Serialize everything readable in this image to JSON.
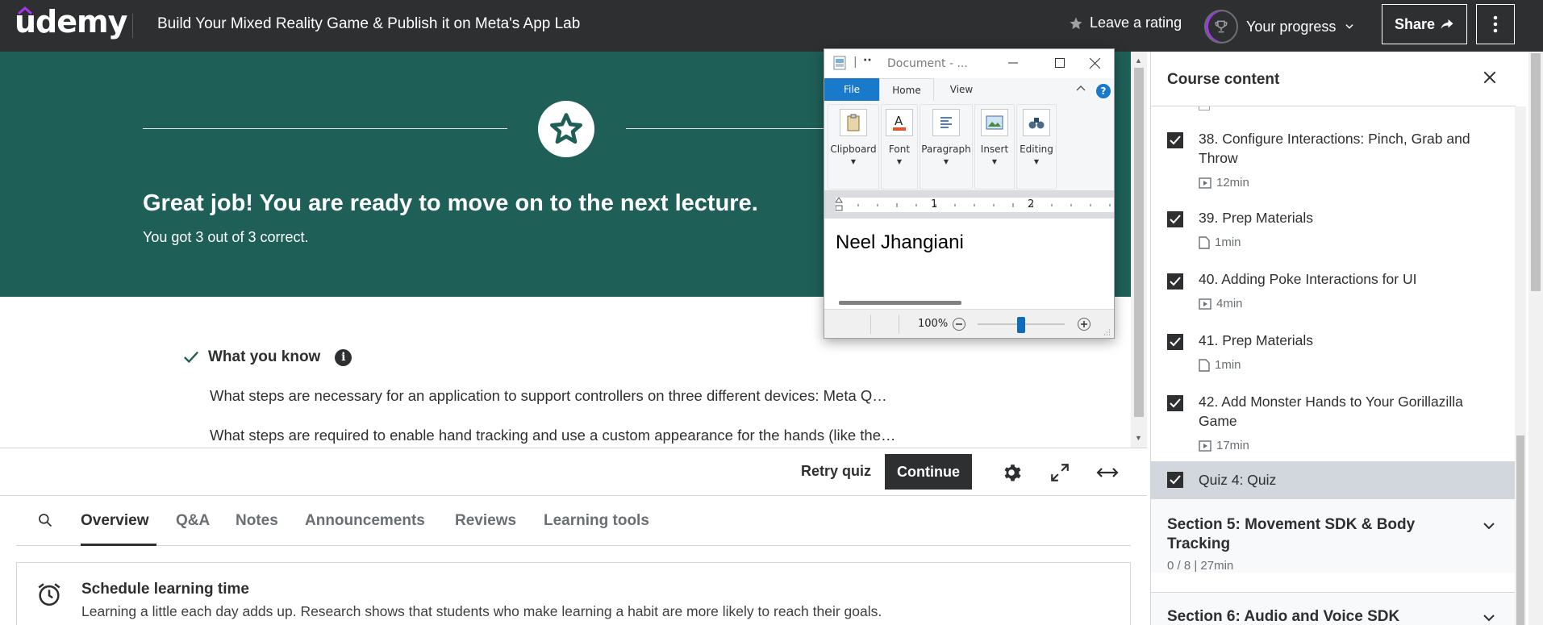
{
  "header": {
    "logo": "udemy",
    "course_title": "Build Your Mixed Reality Game & Publish it on Meta's App Lab",
    "leave_rating": "Leave a rating",
    "your_progress": "Your progress",
    "share": "Share",
    "brand_color": "#a435f0"
  },
  "banner": {
    "headline": "Great job! You are ready to move on to the next lecture.",
    "score": "You got 3 out of 3 correct.",
    "bg_color": "#1e5f57"
  },
  "know": {
    "title": "What you know",
    "questions": [
      "What steps are necessary for an application to support controllers on three different devices: Meta Q…",
      "What steps are required to enable hand tracking and use a custom appearance for the hands (like the…"
    ]
  },
  "actions": {
    "retry": "Retry quiz",
    "continue": "Continue"
  },
  "tabs": [
    "Overview",
    "Q&A",
    "Notes",
    "Announcements",
    "Reviews",
    "Learning tools"
  ],
  "schedule": {
    "title": "Schedule learning time",
    "text": "Learning a little each day adds up. Research shows that students who make learning a habit are more likely to reach their goals."
  },
  "sidebar": {
    "title": "Course content",
    "items": [
      {
        "title": "38. Configure Interactions: Pinch, Grab and Throw",
        "duration": "12min",
        "type": "video-icon",
        "checked": true
      },
      {
        "title": "39. Prep Materials",
        "duration": "1min",
        "type": "file-icon",
        "checked": true
      },
      {
        "title": "40. Adding Poke Interactions for UI",
        "duration": "4min",
        "type": "video-icon",
        "checked": true
      },
      {
        "title": "41. Prep Materials",
        "duration": "1min",
        "type": "file-icon",
        "checked": true
      },
      {
        "title": "42. Add Monster Hands to Your Gorillazilla Game",
        "duration": "17min",
        "type": "video-icon",
        "checked": true
      },
      {
        "title": "Quiz 4: Quiz",
        "duration": "",
        "type": "quiz",
        "checked": true
      }
    ],
    "sections": [
      {
        "title": "Section 5: Movement SDK & Body Tracking",
        "meta": "0 / 8 | 27min"
      },
      {
        "title": "Section 6: Audio and Voice SDK",
        "meta": ""
      }
    ]
  },
  "wordpad": {
    "doc_title": "Document - ...",
    "quick_access": "··",
    "tabs": [
      "File",
      "Home",
      "View"
    ],
    "groups": [
      "Clipboard",
      "Font",
      "Paragraph",
      "Insert",
      "Editing"
    ],
    "ruler_marks": [
      "1",
      "2"
    ],
    "body_text": "Neel Jhangiani",
    "zoom": "100%",
    "zoom_level": 0.5
  }
}
